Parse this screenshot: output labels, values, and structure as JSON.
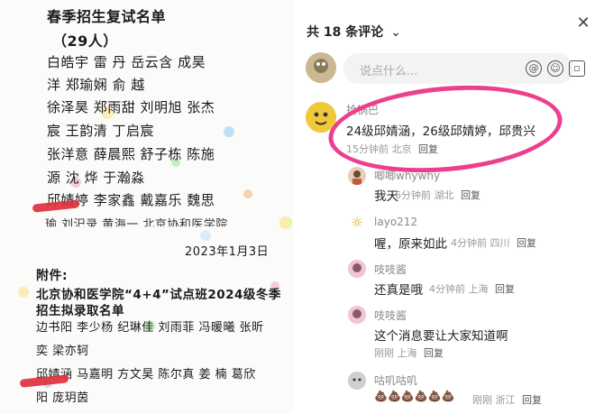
{
  "document": {
    "title": "春季招生复试名单",
    "count": "（29人）",
    "names_rows": [
      "白皓宇  雷  丹  岳云含  成昊",
      "洋  郑瑜娴   俞  越",
      "徐泽昊  郑雨甜   刘明旭  张杰",
      "宸  王韵清   丁启宸",
      "张洋意  薛晨熙  舒子栋  陈施",
      "源  沈  烨   于瀚淼",
      "邱婧婷   李家鑫  戴嘉乐  魏思"
    ],
    "cut_row": "瑜  刘汜录   黄海一  北京协和医学院",
    "date": "2023年1月3日",
    "attachment_label": "附件:",
    "notice_title_1": "北京协和医学院“4+4”试点班2024级冬季",
    "notice_title_2": "招生拟录取名单",
    "admit_rows": [
      "边书阳  李少杨  纪琳佳  刘雨菲  冯暖曦  张昕",
      "奕  梁亦轲",
      "邱婧涵  马嘉明  方文昊  陈尔真  姜    楠  葛欣",
      "阳  庞玥茵"
    ]
  },
  "comments_panel": {
    "header": "共 18 条评论",
    "header_icon": "chevron-down-icon",
    "close_icon": "close-icon",
    "input_placeholder": "说点什么...",
    "input_icons": [
      "at-icon",
      "emoji-icon",
      "image-icon"
    ],
    "highlight_color": "#ec3f8f",
    "comments": [
      {
        "user": "拾锅巴",
        "content": "24级邱婧涵，26级邱婧婷，邱贵兴",
        "time": "15分钟前",
        "location": "北京",
        "reply": "回复"
      },
      {
        "user": "唧唧whywhy",
        "content": "我天",
        "time": "6分钟前",
        "location": "湖北",
        "reply": "回复"
      },
      {
        "user": "layo212",
        "content": "喔，原来如此",
        "time": "4分钟前",
        "location": "四川",
        "reply": "回复"
      },
      {
        "user": "吱吱酱",
        "content": "还真是哦",
        "time": "4分钟前",
        "location": "上海",
        "reply": "回复"
      },
      {
        "user": "吱吱酱",
        "content": "这个消息要让大家知道啊",
        "time": "刚刚",
        "location": "上海",
        "reply": "回复"
      },
      {
        "user": "咕叽咕叽",
        "content": "💩💩💩💩💩💩",
        "time": "刚刚",
        "location": "浙江",
        "reply": "回复"
      }
    ]
  }
}
